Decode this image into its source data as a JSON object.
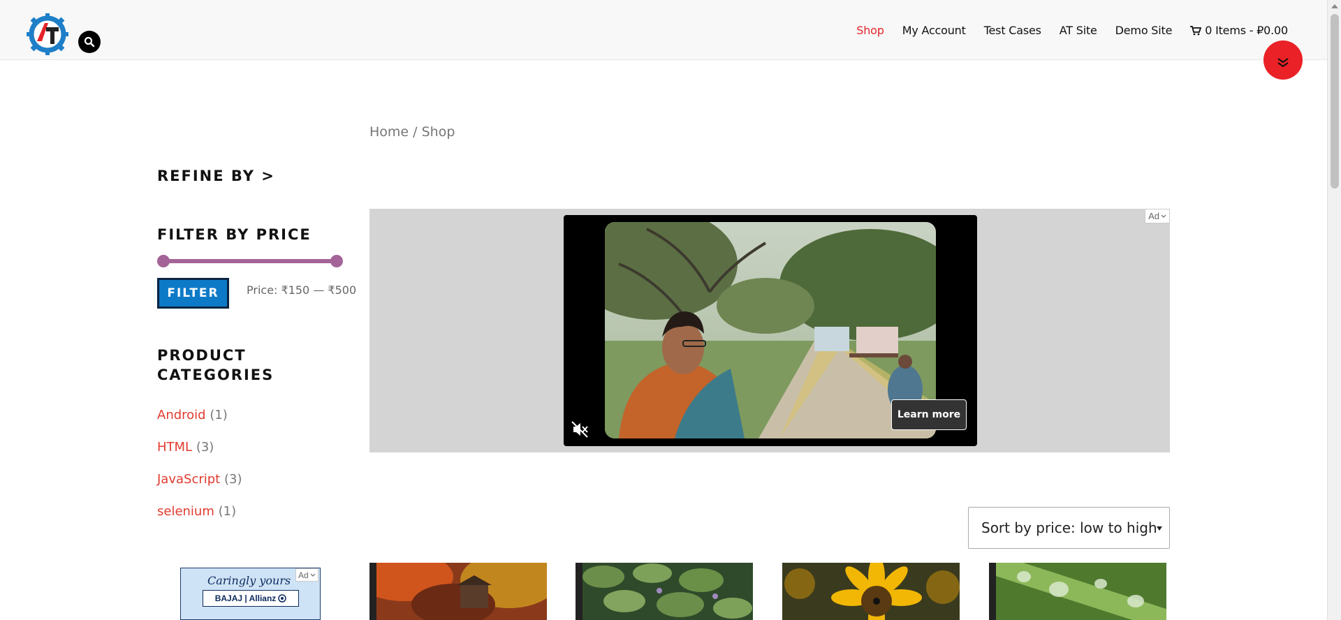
{
  "header": {
    "nav": [
      {
        "label": "Shop",
        "active": true
      },
      {
        "label": "My Account",
        "active": false
      },
      {
        "label": "Test Cases",
        "active": false
      },
      {
        "label": "AT Site",
        "active": false
      },
      {
        "label": "Demo Site",
        "active": false
      }
    ],
    "cart_label": "0 Items - ₽0.00"
  },
  "breadcrumb": {
    "home": "Home",
    "separator": "/",
    "current": "Shop"
  },
  "sidebar": {
    "refine_title": "REFINE BY >",
    "price_filter": {
      "title": "FILTER BY PRICE",
      "button_label": "FILTER",
      "price_label": "Price: ₹150 — ₹500",
      "range": [
        0,
        1
      ]
    },
    "categories": {
      "title": "PRODUCT CATEGORIES",
      "items": [
        {
          "name": "Android",
          "count": "(1)"
        },
        {
          "name": "HTML",
          "count": "(3)"
        },
        {
          "name": "JavaScript",
          "count": "(3)"
        },
        {
          "name": "selenium",
          "count": "(1)"
        }
      ]
    },
    "ad": {
      "tag": "Ad",
      "headline": "Caringly yours",
      "brand": "BAJAJ | Allianz"
    }
  },
  "main_ad": {
    "tag": "Ad",
    "cta": "Learn more"
  },
  "sort": {
    "selected": "Sort by price: low to high"
  },
  "products": [
    {
      "image": "autumn-mill"
    },
    {
      "image": "water-lilies"
    },
    {
      "image": "sunflower"
    },
    {
      "image": "water-drops"
    }
  ],
  "colors": {
    "accent": "#e6232a",
    "link": "#e23a2f",
    "slider": "#a46497",
    "button": "#0d7ac8"
  }
}
